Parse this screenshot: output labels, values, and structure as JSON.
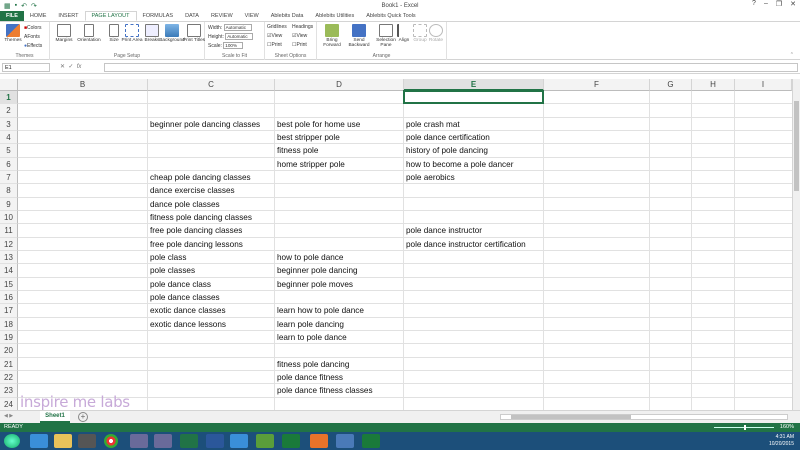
{
  "window": {
    "title": "Book1 - Excel"
  },
  "tabs": [
    "FILE",
    "HOME",
    "INSERT",
    "PAGE LAYOUT",
    "FORMULAS",
    "DATA",
    "REVIEW",
    "VIEW",
    "Ablebits Data",
    "Ablebits Utilities",
    "Ablebits Quick Tools"
  ],
  "active_tab": "PAGE LAYOUT",
  "ribbon": {
    "themes": {
      "label": "Themes",
      "themes_btn": "Themes",
      "colors": "Colors",
      "fonts": "Fonts",
      "effects": "Effects"
    },
    "page_setup": {
      "label": "Page Setup",
      "margins": "Margins",
      "orientation": "Orientation",
      "size": "Size",
      "print_area": "Print Area",
      "breaks": "Breaks",
      "background": "Background",
      "print_titles": "Print Titles"
    },
    "scale_to_fit": {
      "label": "Scale to Fit",
      "width": "Width:",
      "width_val": "Automatic",
      "height": "Height:",
      "height_val": "Automatic",
      "scale": "Scale:",
      "scale_val": "100%"
    },
    "sheet_options": {
      "label": "Sheet Options",
      "gridlines": "Gridlines",
      "headings": "Headings",
      "view": "View",
      "print": "Print"
    },
    "arrange": {
      "label": "Arrange",
      "bring_forward": "Bring Forward",
      "send_backward": "Send Backward",
      "selection_pane": "Selection Pane",
      "align": "Align",
      "group": "Group",
      "rotate": "Rotate"
    }
  },
  "formula_bar": {
    "name_box": "E1",
    "fx": "fx",
    "value": ""
  },
  "columns": [
    "B",
    "C",
    "D",
    "E",
    "F",
    "G",
    "H",
    "I"
  ],
  "selected_column": "E",
  "rows": [
    "1",
    "2",
    "3",
    "4",
    "5",
    "6",
    "7",
    "8",
    "9",
    "10",
    "11",
    "12",
    "13",
    "14",
    "15",
    "16",
    "17",
    "18",
    "19",
    "20",
    "21",
    "22",
    "23",
    "24"
  ],
  "selected_row": "1",
  "cells": {
    "C": {
      "3": "beginner pole dancing classes",
      "7": "cheap pole dancing classes",
      "8": "dance exercise classes",
      "9": "dance pole classes",
      "10": "fitness pole dancing classes",
      "11": "free pole dancing classes",
      "12": "free pole dancing lessons",
      "13": "pole class",
      "14": "pole classes",
      "15": "pole dance class",
      "16": "pole dance classes",
      "17": "exotic dance classes",
      "18": "exotic dance lessons"
    },
    "D": {
      "3": "best pole for home use",
      "4": "best stripper pole",
      "5": "fitness pole",
      "6": "home stripper pole",
      "13": "how to pole dance",
      "14": "beginner pole dancing",
      "15": "beginner pole moves",
      "17": "learn how to pole dance",
      "18": "learn pole dancing",
      "19": "learn to pole dance",
      "21": "fitness pole dancing",
      "22": "pole dance fitness",
      "23": "pole dance fitness classes"
    },
    "E": {
      "3": "pole crash mat",
      "4": "pole dance certification",
      "5": "history of pole dancing",
      "6": "how to become a pole dancer",
      "7": "pole aerobics",
      "11": "pole dance instructor",
      "12": "pole dance instructor certification"
    }
  },
  "sheets": [
    "Sheet1"
  ],
  "status": {
    "ready": "READY",
    "zoom": "160%"
  },
  "taskbar": {
    "time": "4:31 AM",
    "date": "10/20/2015"
  },
  "watermark": "inspire me labs",
  "colors": {
    "excel_green": "#217346",
    "taskbar": "#1c4f7a"
  }
}
